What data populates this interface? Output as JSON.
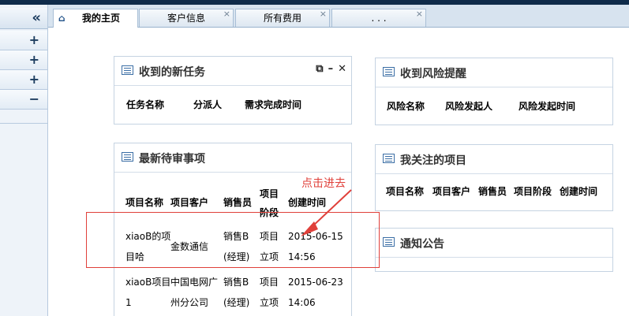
{
  "sidebar": {
    "collapse_icon": "double-chevron-left-icon",
    "rows": [
      {
        "icon": "plus-icon",
        "glyph": "+"
      },
      {
        "icon": "plus-icon",
        "glyph": "+"
      },
      {
        "icon": "plus-icon",
        "glyph": "+"
      },
      {
        "icon": "minus-icon",
        "glyph": "−"
      }
    ]
  },
  "tabs": [
    {
      "label": "我的主页",
      "active": true,
      "closable": false
    },
    {
      "label": "客户信息",
      "active": false,
      "closable": true
    },
    {
      "label": "所有费用",
      "active": false,
      "closable": true
    },
    {
      "label": ". . .",
      "active": false,
      "closable": true
    }
  ],
  "panels": {
    "new_tasks": {
      "title": "收到的新任务",
      "columns": [
        "任务名称",
        "分派人",
        "需求完成时间"
      ]
    },
    "risk": {
      "title": "收到风险提醒",
      "columns": [
        "风险名称",
        "风险发起人",
        "风险发起时间"
      ]
    },
    "pending": {
      "title": "最新待审事项",
      "columns": [
        "项目名称",
        "项目客户",
        "销售员",
        "项目阶段",
        "创建时间"
      ],
      "rows": [
        {
          "name": [
            "xiaoB的项",
            "目哈"
          ],
          "customer": [
            "金数通信"
          ],
          "sales": [
            "销售B",
            "(经理)"
          ],
          "stage": [
            "项目",
            "立项"
          ],
          "time": [
            "2015-06-15",
            "14:56"
          ]
        },
        {
          "name": [
            "xiaoB项目",
            "1"
          ],
          "customer": [
            "中国电网广",
            "州分公司"
          ],
          "sales": [
            "销售B",
            "(经理)"
          ],
          "stage": [
            "项目",
            "立项"
          ],
          "time": [
            "2015-06-23",
            "14:06"
          ]
        }
      ]
    },
    "followed": {
      "title": "我关注的项目",
      "columns": [
        "项目名称",
        "项目客户",
        "销售员",
        "项目阶段",
        "创建时间"
      ]
    },
    "notice": {
      "title": "通知公告"
    }
  },
  "annotation": {
    "text": "点击进去",
    "color": "#e0403a"
  }
}
